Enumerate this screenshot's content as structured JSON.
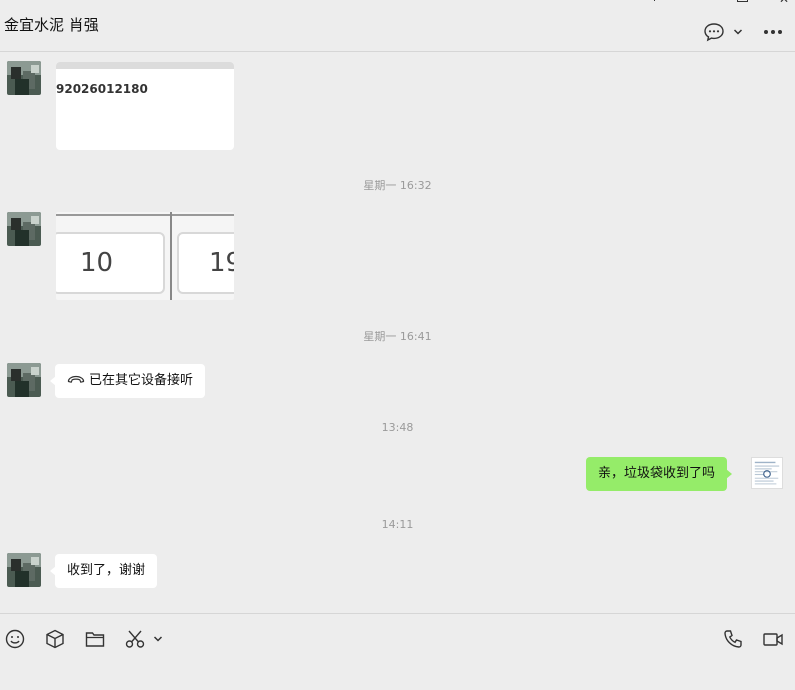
{
  "header": {
    "title": "金宜水泥 肖强",
    "close_glyph": "✕"
  },
  "messages": {
    "card_number": "92026012180",
    "time1": "星期一 16:32",
    "image_cell1": "10",
    "image_cell2": "19",
    "time2": "星期一 16:41",
    "call_text": "已在其它设备接听",
    "time3": "13:48",
    "my_message": "亲，垃圾袋收到了吗",
    "time4": "14:11",
    "reply": "收到了，谢谢"
  },
  "colors": {
    "background": "#ededed",
    "my_bubble": "#95ec69",
    "their_bubble": "#ffffff",
    "timestamp": "#9a9a9a"
  },
  "icons": {
    "header": [
      "chat-bubble-icon",
      "chevron-down-icon",
      "more-icon"
    ],
    "toolbar": [
      "emoji-icon",
      "sticker-box-icon",
      "folder-icon",
      "scissors-icon",
      "chevron-down-icon",
      "phone-icon",
      "video-icon"
    ]
  }
}
